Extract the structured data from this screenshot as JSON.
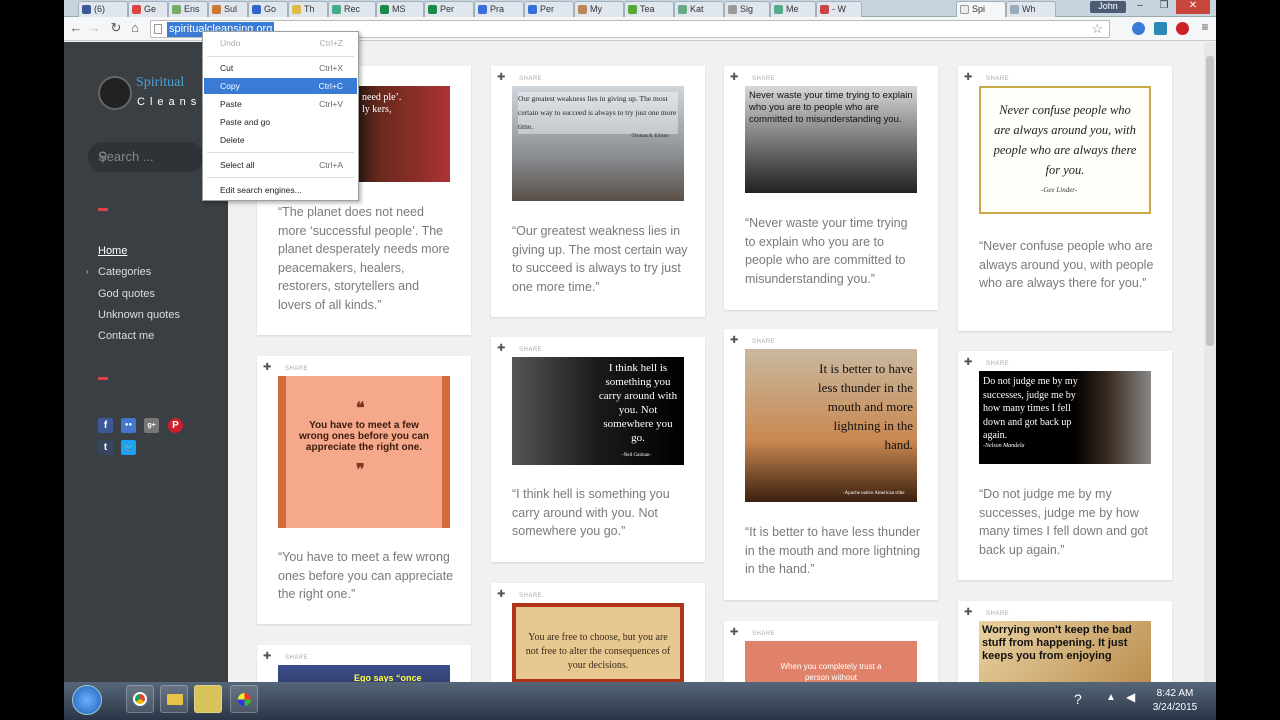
{
  "browser": {
    "tabs": [
      "(6)",
      "Ge",
      "Ens",
      "Sul",
      "Go",
      "Th",
      "Rec",
      "MS",
      "Per",
      "Pra",
      "Per",
      "My",
      "Tea",
      "Kat",
      "Sig",
      "Me",
      "- W",
      "Spi",
      "Wh"
    ],
    "profile": "John",
    "url": "spiritualcleansing.org",
    "window_controls": [
      "–",
      "❐",
      "✕"
    ]
  },
  "context_menu": {
    "items": [
      {
        "label": "Undo",
        "shortcut": "Ctrl+Z",
        "disabled": true
      },
      {
        "label": "Cut",
        "shortcut": "Ctrl+X"
      },
      {
        "label": "Copy",
        "shortcut": "Ctrl+C",
        "highlighted": true
      },
      {
        "label": "Paste",
        "shortcut": "Ctrl+V"
      },
      {
        "label": "Paste and go",
        "shortcut": ""
      },
      {
        "label": "Delete",
        "shortcut": ""
      },
      {
        "label": "Select all",
        "shortcut": "Ctrl+A"
      },
      {
        "label": "Edit search engines...",
        "shortcut": ""
      }
    ]
  },
  "sidebar": {
    "logo_line1": "Spiritual",
    "logo_line2": "Cleansi",
    "search_placeholder": "Search ...",
    "menu": [
      "Home",
      "Categories",
      "God quotes",
      "Unknown quotes",
      "Contact me"
    ],
    "social": [
      "f",
      "●●",
      "g+",
      "P",
      "t",
      "🐦"
    ]
  },
  "share_label": "SHARE",
  "cards": [
    {
      "caption": "“The planet does not need more ‘successful people’. The planet desperately needs more peacemakers, healers, restorers, storytellers and lovers of all kinds.”",
      "img_text": "need ple’. ly kers,"
    },
    {
      "caption": "“Our greatest weakness lies in giving up. The most certain way to succeed is always to try just one more time.”",
      "img_text": "Our greatest weakness lies in giving up. The most certain way to succeed is always to try just one more time.",
      "img_author": "-Thomas A. Edison"
    },
    {
      "caption": "“Never waste your time trying to explain who you are to people who are committed to misunderstanding you.”",
      "img_text": "Never waste your time trying to explain who you are to people who are committed to misunderstanding you."
    },
    {
      "caption": "“Never confuse people who are always around you, with people who are always there for you.”",
      "img_text": "Never confuse people who are always around you, with people who are always there for you.",
      "img_author": "-Gee Linder-"
    },
    {
      "caption": "“You have to meet a few wrong ones before you can appreciate the right one.”",
      "img_text": "You have to meet a few wrong ones before you can appreciate the right one."
    },
    {
      "caption": "“I think hell is something you carry around with you. Not somewhere you go.”",
      "img_text": "I think hell is something you carry around with you. Not somewhere you go.",
      "img_author": "-Neil Gaiman-"
    },
    {
      "caption": "“It is better to have less thunder in the mouth and more lightning in the hand.”",
      "img_text": "It is better to have less thunder in the mouth and more lightning in the hand.",
      "img_author": "-Apache native American tribe"
    },
    {
      "caption": "“Do not judge me by my successes, judge me by how many times I fell down and got back up again.”",
      "img_text": "Do not judge me by my successes, judge me by how many times I fell down and got back up again.",
      "img_author": "-Nelson Mandela"
    },
    {
      "caption": "",
      "img_text": "Ego says “once"
    },
    {
      "caption": "",
      "img_text": "You are free to choose, but you are not free to alter the consequences of your decisions."
    },
    {
      "caption": "",
      "img_text": "When you completely trust a person without"
    },
    {
      "caption": "",
      "img_text": "Worrying won't keep the bad stuff from happening. It just keeps you from enjoying"
    }
  ],
  "taskbar": {
    "time": "8:42 AM",
    "date": "3/24/2015"
  }
}
